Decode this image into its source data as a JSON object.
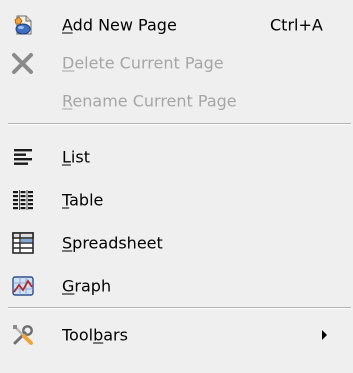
{
  "menu": {
    "items": [
      {
        "pre": "",
        "mn": "A",
        "post": "dd New Page",
        "shortcut": "Ctrl+A",
        "icon": "add-page-icon",
        "enabled": true
      },
      {
        "pre": "",
        "mn": "D",
        "post": "elete Current Page",
        "shortcut": "",
        "icon": "delete-x-icon",
        "enabled": false
      },
      {
        "pre": "",
        "mn": "R",
        "post": "ename Current Page",
        "shortcut": "",
        "icon": "",
        "enabled": false
      },
      {
        "pre": "",
        "mn": "L",
        "post": "ist",
        "shortcut": "",
        "icon": "list-icon",
        "enabled": true
      },
      {
        "pre": "",
        "mn": "T",
        "post": "able",
        "shortcut": "",
        "icon": "table-icon",
        "enabled": true
      },
      {
        "pre": "",
        "mn": "S",
        "post": "preadsheet",
        "shortcut": "",
        "icon": "spreadsheet-icon",
        "enabled": true
      },
      {
        "pre": "",
        "mn": "G",
        "post": "raph",
        "shortcut": "",
        "icon": "graph-icon",
        "enabled": true
      },
      {
        "pre": "Tool",
        "mn": "b",
        "post": "ars",
        "shortcut": "",
        "icon": "toolbars-tools-icon",
        "enabled": true,
        "submenu": true
      }
    ]
  },
  "colors": {
    "background": "#efefef",
    "text": "#000000",
    "disabled_text": "#a6a6a6",
    "separator_dark": "#b4b4b4",
    "separator_light": "#ffffff"
  }
}
